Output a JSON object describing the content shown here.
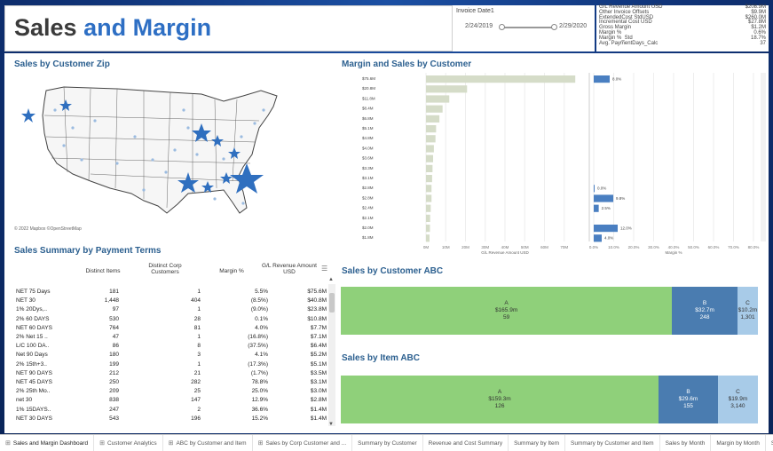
{
  "header": {
    "title_part1": "Sales",
    "title_part2": "and Margin"
  },
  "date_filter": {
    "label": "Invoice Date1",
    "start": "2/24/2019",
    "end": "2/29/2020"
  },
  "kpis": [
    {
      "label": "G/L Revenue Amount USD",
      "value": "$208.9M"
    },
    {
      "label": "Other Invoice Offsets",
      "value": "$9.9M"
    },
    {
      "label": "ExtendedCost StdUSD",
      "value": "$260.0M"
    },
    {
      "label": "Incremental Cost USD",
      "value": "$27.8M"
    },
    {
      "label": "Gross Margin",
      "value": "$1.2M"
    },
    {
      "label": "Margin %",
      "value": "0.6%"
    },
    {
      "label": "Margin %_Std",
      "value": "18.7%"
    },
    {
      "label": "Avg. PaymentDays_Calc",
      "value": "37"
    }
  ],
  "sections": {
    "zip": "Sales by Customer Zip",
    "margin_sales": "Margin and Sales by Customer",
    "payment_terms": "Sales Summary by Payment Terms",
    "customer_abc": "Sales by Customer ABC",
    "item_abc": "Sales by Item ABC"
  },
  "map": {
    "attribution": "© 2022 Mapbox ©OpenStreetMap",
    "marker_color": "#2f6fbf"
  },
  "chart_data": {
    "type": "bar",
    "categories": [
      "$75.6M",
      "$20.8M",
      "$11.8M",
      "$8.4M",
      "$6.8M",
      "$5.1M",
      "$4.8M",
      "$4.0M",
      "$3.6M",
      "$3.3M",
      "$3.1M",
      "$2.8M",
      "$2.8M",
      "$2.4M",
      "$2.1M",
      "$2.0M",
      "$1.8M"
    ],
    "series": [
      {
        "values": [
          75.6,
          20.8,
          11.8,
          8.4,
          6.8,
          5.1,
          4.8,
          4.0,
          3.6,
          3.3,
          3.1,
          2.8,
          2.8,
          2.4,
          2.1,
          2.0,
          1.8
        ]
      },
      {
        "values": [
          8.0,
          null,
          null,
          null,
          null,
          null,
          null,
          null,
          null,
          null,
          null,
          0.0,
          9.8,
          2.5,
          null,
          12.0,
          4.0
        ]
      }
    ],
    "margin_labels": [
      "8.0%",
      "",
      "",
      "",
      "",
      "",
      "",
      "",
      "",
      "",
      "",
      "0.0%",
      "9.8%",
      "2.5%",
      "",
      "12.0%",
      "4.0%"
    ],
    "left_axis": {
      "label": "G/L Revenue Amount USD",
      "ticks": [
        "0M",
        "10M",
        "20M",
        "30M",
        "40M",
        "50M",
        "60M",
        "70M"
      ],
      "max": 80
    },
    "right_axis": {
      "label": "Margin %",
      "ticks": [
        "0.0%",
        "10.0%",
        "20.0%",
        "30.0%",
        "40.0%",
        "50.0%",
        "60.0%",
        "70.0%",
        "80.0%"
      ],
      "max": 80
    },
    "colors": {
      "revenue": "#d5dcc8",
      "margin": "#4a7fc1"
    }
  },
  "table": {
    "headers": [
      "Distinct Items",
      "Distinct Corp Customers",
      "Margin %",
      "G/L Revenue Amount USD"
    ],
    "rows": [
      [
        "NET 75 Days",
        "181",
        "1",
        "5.5%",
        "$75.6M"
      ],
      [
        "NET 30",
        "1,448",
        "404",
        "(8.5%)",
        "$40.8M"
      ],
      [
        "1% 20Dys,..",
        "97",
        "1",
        "(9.0%)",
        "$23.8M"
      ],
      [
        "2% 60 DAYS",
        "530",
        "28",
        "0.1%",
        "$10.8M"
      ],
      [
        "NET 60 DAYS",
        "764",
        "81",
        "4.0%",
        "$7.7M"
      ],
      [
        "2% Net 15 ..",
        "47",
        "1",
        "(16.8%)",
        "$7.1M"
      ],
      [
        "L/C 100 DA..",
        "86",
        "8",
        "(37.5%)",
        "$6.4M"
      ],
      [
        "Net 90 Days",
        "180",
        "3",
        "4.1%",
        "$5.2M"
      ],
      [
        "2% 15th+3..",
        "199",
        "1",
        "(17.3%)",
        "$5.1M"
      ],
      [
        "NET 90 DAYS",
        "212",
        "21",
        "(1.7%)",
        "$3.5M"
      ],
      [
        "NET 45 DAYS",
        "250",
        "282",
        "78.8%",
        "$3.1M"
      ],
      [
        "2% 25th Mo..",
        "209",
        "25",
        "25.0%",
        "$3.0M"
      ],
      [
        "net 30",
        "838",
        "147",
        "12.9%",
        "$2.8M"
      ],
      [
        "1% 15DAYS..",
        "247",
        "2",
        "36.6%",
        "$1.4M"
      ],
      [
        "NET 30 DAYS",
        "543",
        "196",
        "15.2%",
        "$1.4M"
      ]
    ]
  },
  "customer_abc": [
    {
      "name": "A",
      "amount": "$165.9m",
      "count": "59",
      "share": 0.794,
      "color": "#8fd07a"
    },
    {
      "name": "B",
      "amount": "$32.7m",
      "count": "248",
      "share": 0.157,
      "color": "#4a7cb0"
    },
    {
      "name": "C",
      "amount": "$10.2m",
      "count": "1,301",
      "share": 0.049,
      "color": "#a8cbe8"
    }
  ],
  "item_abc": [
    {
      "name": "A",
      "amount": "$159.3m",
      "count": "126",
      "share": 0.762,
      "color": "#8fd07a"
    },
    {
      "name": "B",
      "amount": "$29.6m",
      "count": "155",
      "share": 0.142,
      "color": "#4a7cb0"
    },
    {
      "name": "C",
      "amount": "$19.9m",
      "count": "3,140",
      "share": 0.096,
      "color": "#a8cbe8"
    }
  ],
  "tabs": [
    {
      "label": "Sales and Margin Dashboard",
      "active": true
    },
    {
      "label": "Customer Analytics"
    },
    {
      "label": "ABC by Customer and Item"
    },
    {
      "label": "Sales by Corp Customer and ..."
    },
    {
      "label": "Summary by Customer"
    },
    {
      "label": "Revenue and Cost Summary"
    },
    {
      "label": "Summary by Item"
    },
    {
      "label": "Summary by Customer and Item"
    },
    {
      "label": "Sales by Month"
    },
    {
      "label": "Margin by Month"
    },
    {
      "label": "Sal"
    }
  ]
}
